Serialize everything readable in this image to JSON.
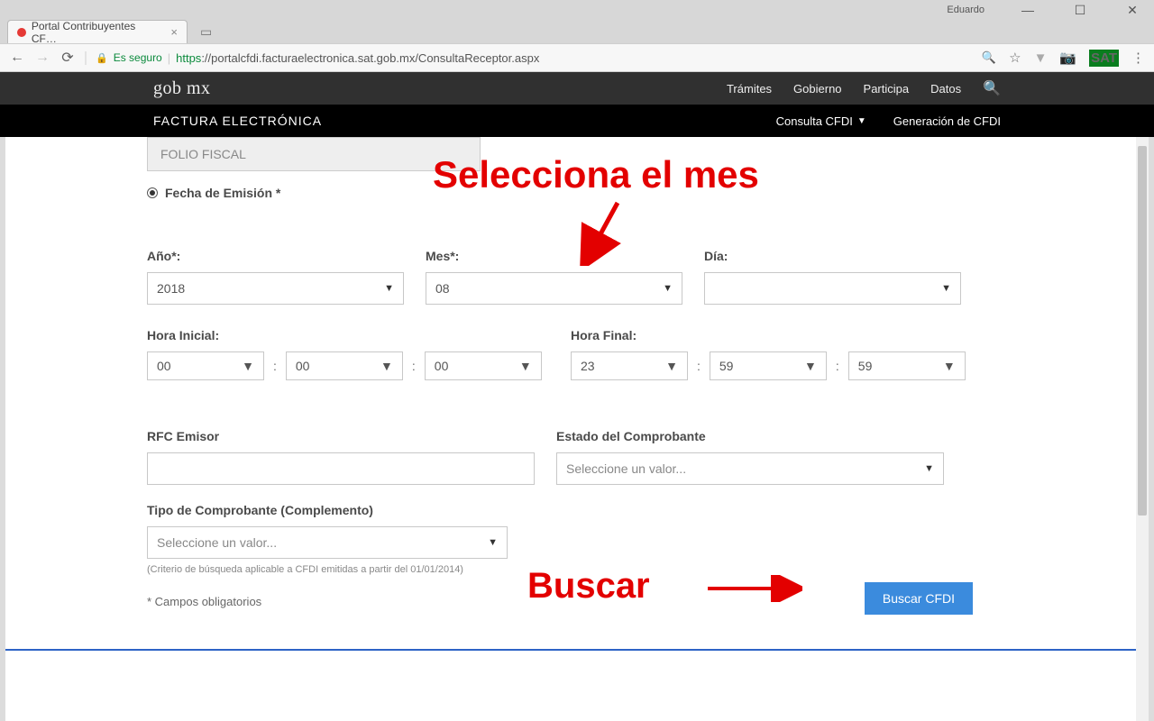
{
  "window": {
    "user": "Eduardo",
    "tab_title": "Portal Contribuyentes CF…"
  },
  "address_bar": {
    "secure_label": "Es seguro",
    "scheme": "https",
    "url_rest": "://portalcfdi.facturaelectronica.sat.gob.mx/ConsultaReceptor.aspx",
    "sat_badge": "SAT"
  },
  "gob_header": {
    "logo": "gob mx",
    "nav": [
      "Trámites",
      "Gobierno",
      "Participa",
      "Datos"
    ]
  },
  "sub_header": {
    "title": "FACTURA ELECTRÓNICA",
    "nav": [
      "Consulta CFDI",
      "Generación de CFDI"
    ]
  },
  "form": {
    "folio_placeholder": "FOLIO FISCAL",
    "fecha_emision_label": "Fecha de Emisión *",
    "ano_label": "Año*:",
    "ano_value": "2018",
    "mes_label": "Mes*:",
    "mes_value": "08",
    "dia_label": "Día:",
    "dia_value": "",
    "hora_inicial_label": "Hora Inicial:",
    "hora_inicial": {
      "h": "00",
      "m": "00",
      "s": "00"
    },
    "hora_final_label": "Hora Final:",
    "hora_final": {
      "h": "23",
      "m": "59",
      "s": "59"
    },
    "rfc_emisor_label": "RFC Emisor",
    "estado_label": "Estado del Comprobante",
    "estado_placeholder": "Seleccione un valor...",
    "tipo_label": "Tipo de Comprobante (Complemento)",
    "tipo_placeholder": "Seleccione un valor...",
    "criterio_hint": "(Criterio de búsqueda aplicable a CFDI emitidas a partir del 01/01/2014)",
    "campos_oblig": "* Campos obligatorios",
    "buscar_btn": "Buscar CFDI"
  },
  "annotations": {
    "mes": "Selecciona el mes",
    "buscar": "Buscar"
  }
}
